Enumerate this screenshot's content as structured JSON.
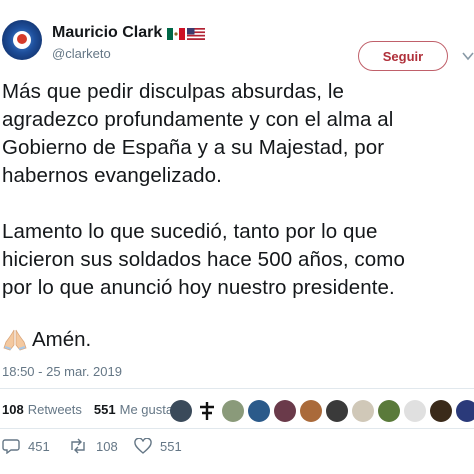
{
  "user": {
    "display_name": "Mauricio Clark",
    "handle": "@clarketo",
    "flags": [
      "mexico-flag",
      "usa-flag"
    ]
  },
  "follow_button": {
    "label": "Seguir"
  },
  "tweet": {
    "paragraph1": "Más que pedir disculpas absurdas, le\nagradezco profundamente y con el alma al\nGobierno de España y a su Majestad, por\nhabernos evangelizado.",
    "paragraph2": "Lamento lo que sucedió, tanto por lo que\nhicieron sus soldados hace 500 años, como\npor lo que anunció hoy nuestro presidente.",
    "amen": "Amén.",
    "emoji": "folded-hands-icon"
  },
  "timestamp": "18:50 - 25 mar. 2019",
  "stats": {
    "retweets_count": "108",
    "retweets_label": "Retweets",
    "likes_count": "551",
    "likes_label": "Me gusta"
  },
  "likers": [
    "#3a4a5a",
    "#1a1a1a",
    "#8a9a7a",
    "#2b5a8a",
    "#6a3a4a",
    "#aa6a3a",
    "#3a3a3a",
    "#d0c8b8",
    "#5a7a3a",
    "#e0e0e0",
    "#3a2a1a",
    "#2a3a7a"
  ],
  "actions": {
    "reply_count": "451",
    "retweet_count": "108",
    "like_count": "551"
  },
  "colors": {
    "follow": "#b0303a",
    "secondary_text": "#657786",
    "divider": "#e1e8ed"
  }
}
